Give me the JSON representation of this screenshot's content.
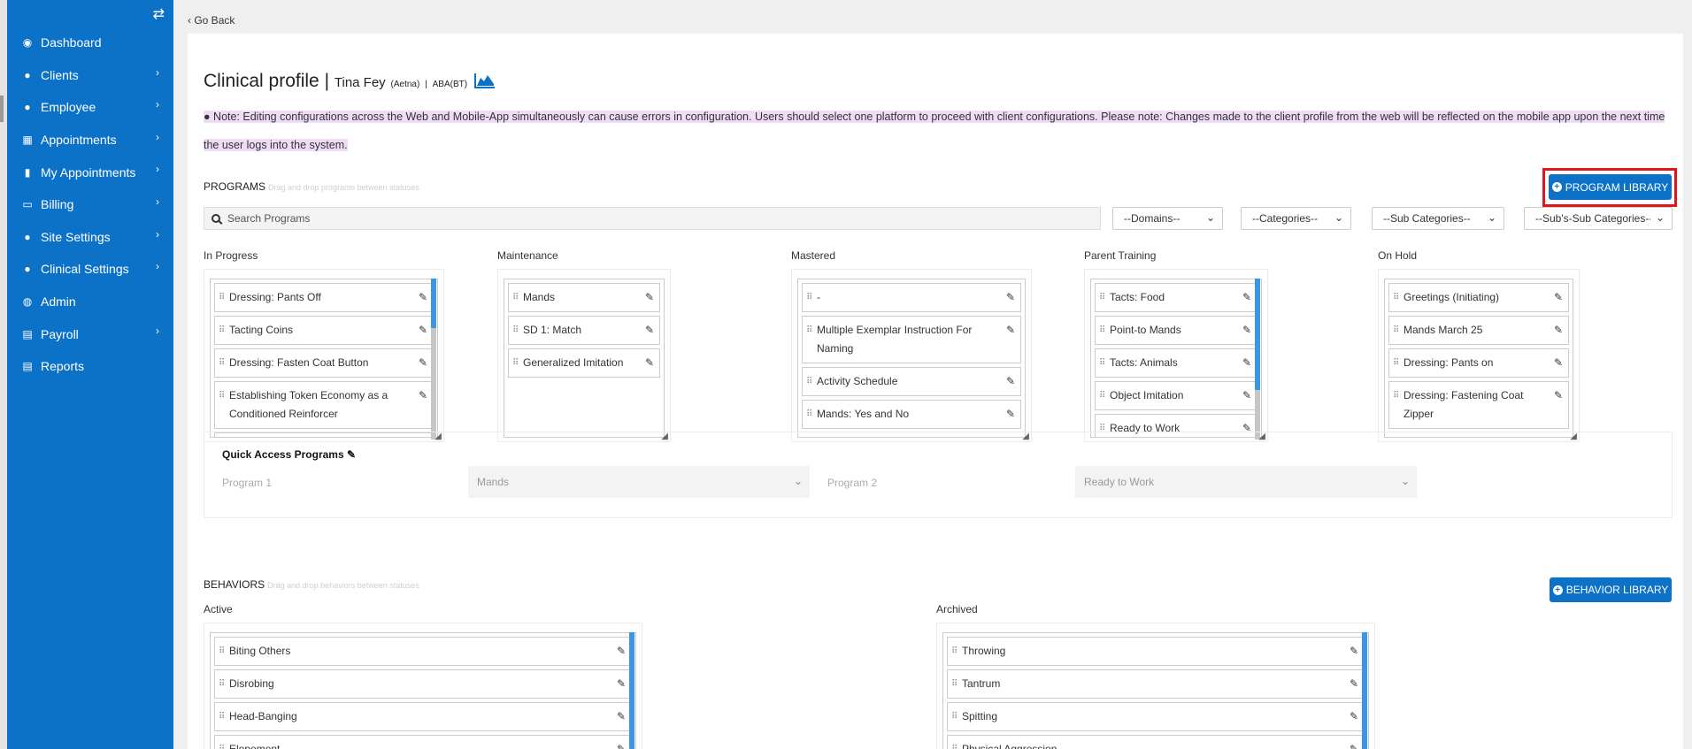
{
  "sidebar": {
    "items": [
      {
        "label": "Dashboard",
        "icon": "dashboard-icon",
        "has_children": false
      },
      {
        "label": "Clients",
        "icon": "user-icon",
        "has_children": true
      },
      {
        "label": "Employee",
        "icon": "user-icon",
        "has_children": true
      },
      {
        "label": "Appointments",
        "icon": "calendar-icon",
        "has_children": true
      },
      {
        "label": "My Appointments",
        "icon": "book-icon",
        "has_children": true
      },
      {
        "label": "Billing",
        "icon": "money-icon",
        "has_children": true
      },
      {
        "label": "Site Settings",
        "icon": "user-icon",
        "has_children": true
      },
      {
        "label": "Clinical Settings",
        "icon": "user-icon",
        "has_children": true
      },
      {
        "label": "Admin",
        "icon": "user-circle-icon",
        "has_children": false
      },
      {
        "label": "Payroll",
        "icon": "card-icon",
        "has_children": true
      },
      {
        "label": "Reports",
        "icon": "card-icon",
        "has_children": false
      }
    ]
  },
  "nav": {
    "go_back": "Go Back"
  },
  "header": {
    "title": "Clinical profile",
    "separator": "|",
    "client_name": "Tina Fey",
    "payer": "(Aetna)",
    "pipe": "|",
    "service": "ABA(BT)"
  },
  "note": {
    "text": "Note: Editing configurations across the Web and Mobile-App simultaneously can cause errors in configuration. Users should select one platform to proceed with client configurations. Please note: Changes made to the client profile from the web will be reflected on the mobile app upon the next time the user logs into the system."
  },
  "programs": {
    "label": "PROGRAMS",
    "hint": "Drag and drop programs between statuses",
    "library_button": "PROGRAM LIBRARY",
    "search_placeholder": "Search Programs",
    "filters": [
      "--Domains--",
      "--Categories--",
      "--Sub Categories--",
      "--Sub's-Sub Categories--"
    ],
    "columns": [
      {
        "title": "In Progress",
        "items": [
          "Dressing: Pants Off",
          "Tacting Coins",
          "Dressing: Fasten Coat Button",
          "Establishing Token Economy as a Conditioned Reinforcer"
        ]
      },
      {
        "title": "Maintenance",
        "items": [
          "Mands",
          "SD 1: Match",
          "Generalized Imitation"
        ]
      },
      {
        "title": "Mastered",
        "items": [
          "-",
          "Multiple Exemplar Instruction For Naming",
          "Activity Schedule",
          "Mands: Yes and No"
        ]
      },
      {
        "title": "Parent Training",
        "items": [
          "Tacts: Food",
          "Point-to Mands",
          "Tacts: Animals",
          "Object Imitation",
          "Ready to Work"
        ]
      },
      {
        "title": "On Hold",
        "items": [
          "Greetings (Initiating)",
          "Mands March 25",
          "Dressing: Pants on",
          "Dressing: Fastening Coat Zipper"
        ]
      }
    ]
  },
  "quick_access": {
    "title": "Quick Access Programs",
    "program1_label": "Program 1",
    "program1_value": "Mands",
    "program2_label": "Program 2",
    "program2_value": "Ready to Work"
  },
  "behaviors": {
    "label": "BEHAVIORS",
    "hint": "Drag and drop behaviors between statuses",
    "library_button": "BEHAVIOR LIBRARY",
    "columns": [
      {
        "title": "Active",
        "items": [
          "Biting Others",
          "Disrobing",
          "Head-Banging",
          "Elopement"
        ]
      },
      {
        "title": "Archived",
        "items": [
          "Throwing",
          "Tantrum",
          "Spitting",
          "Physical Aggression"
        ]
      }
    ]
  },
  "colors": {
    "sidebar": "#0c72c8",
    "accent": "#0c72c8",
    "highlight": "#f0dcf6",
    "alert_outline": "#e2141c"
  }
}
